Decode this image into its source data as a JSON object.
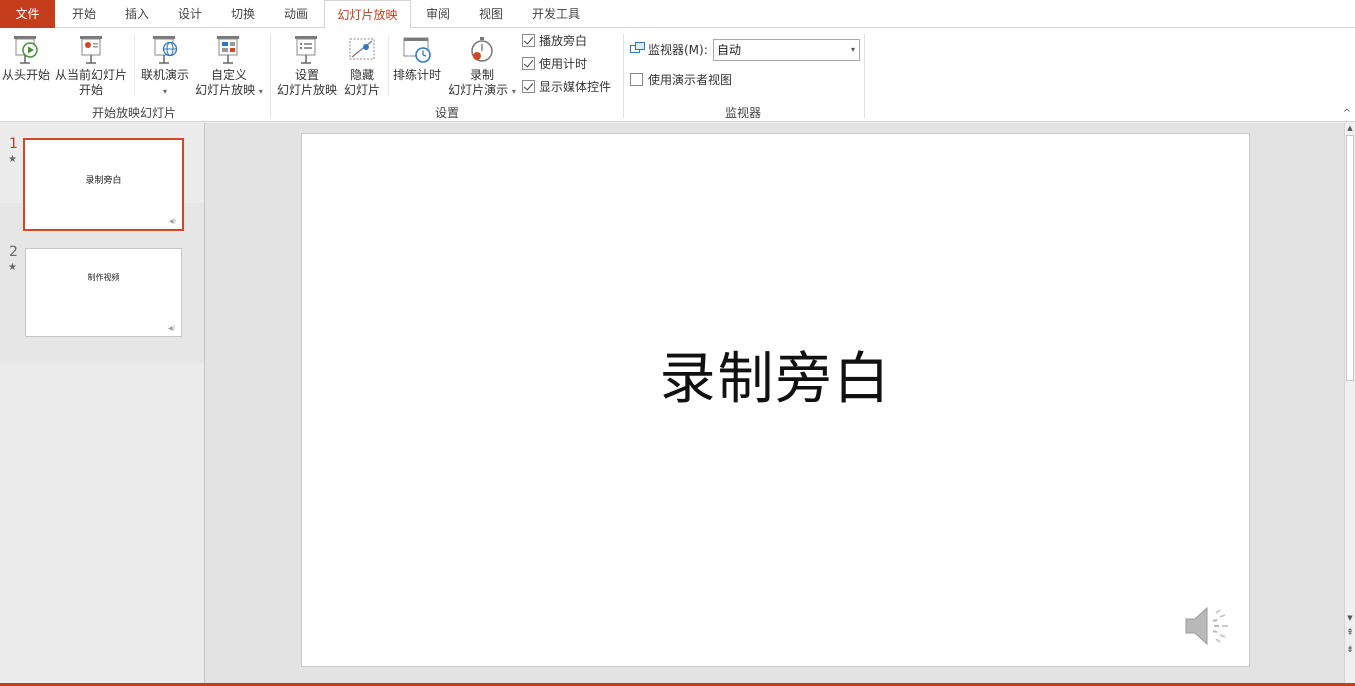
{
  "tabs": [
    {
      "label": "文件",
      "kind": "file"
    },
    {
      "label": "开始"
    },
    {
      "label": "插入"
    },
    {
      "label": "设计"
    },
    {
      "label": "切换"
    },
    {
      "label": "动画"
    },
    {
      "label": "幻灯片放映",
      "active": true
    },
    {
      "label": "审阅"
    },
    {
      "label": "视图"
    },
    {
      "label": "开发工具"
    }
  ],
  "ribbon": {
    "start_group": {
      "label": "开始放映幻灯片",
      "from_beginning": "从头开始",
      "from_current_line1": "从当前幻灯片",
      "from_current_line2": "开始",
      "online_present": "联机演示",
      "custom_line1": "自定义",
      "custom_line2": "幻灯片放映"
    },
    "setup_group": {
      "label": "设置",
      "setup_line1": "设置",
      "setup_line2": "幻灯片放映",
      "hide_line1": "隐藏",
      "hide_line2": "幻灯片",
      "rehearse": "排练计时",
      "record_line1": "录制",
      "record_line2": "幻灯片演示",
      "checkboxes": [
        {
          "label": "播放旁白",
          "checked": true
        },
        {
          "label": "使用计时",
          "checked": true
        },
        {
          "label": "显示媒体控件",
          "checked": true
        }
      ]
    },
    "monitor_group": {
      "label": "监视器",
      "monitor_label": "监视器(M):",
      "monitor_value": "自动",
      "presenter_view": "使用演示者视图",
      "presenter_checked": false
    }
  },
  "thumbnails": [
    {
      "number": "1",
      "star": "★",
      "title": "录制旁白",
      "selected": true
    },
    {
      "number": "2",
      "star": "★",
      "title": "制作视频",
      "selected": false
    }
  ],
  "slide": {
    "title": "录制旁白"
  },
  "colors": {
    "accent": "#c43e1c",
    "selection_border": "#d24726"
  },
  "icons": {
    "speaker": "speaker-icon",
    "checkmark": "checkmark-icon"
  }
}
